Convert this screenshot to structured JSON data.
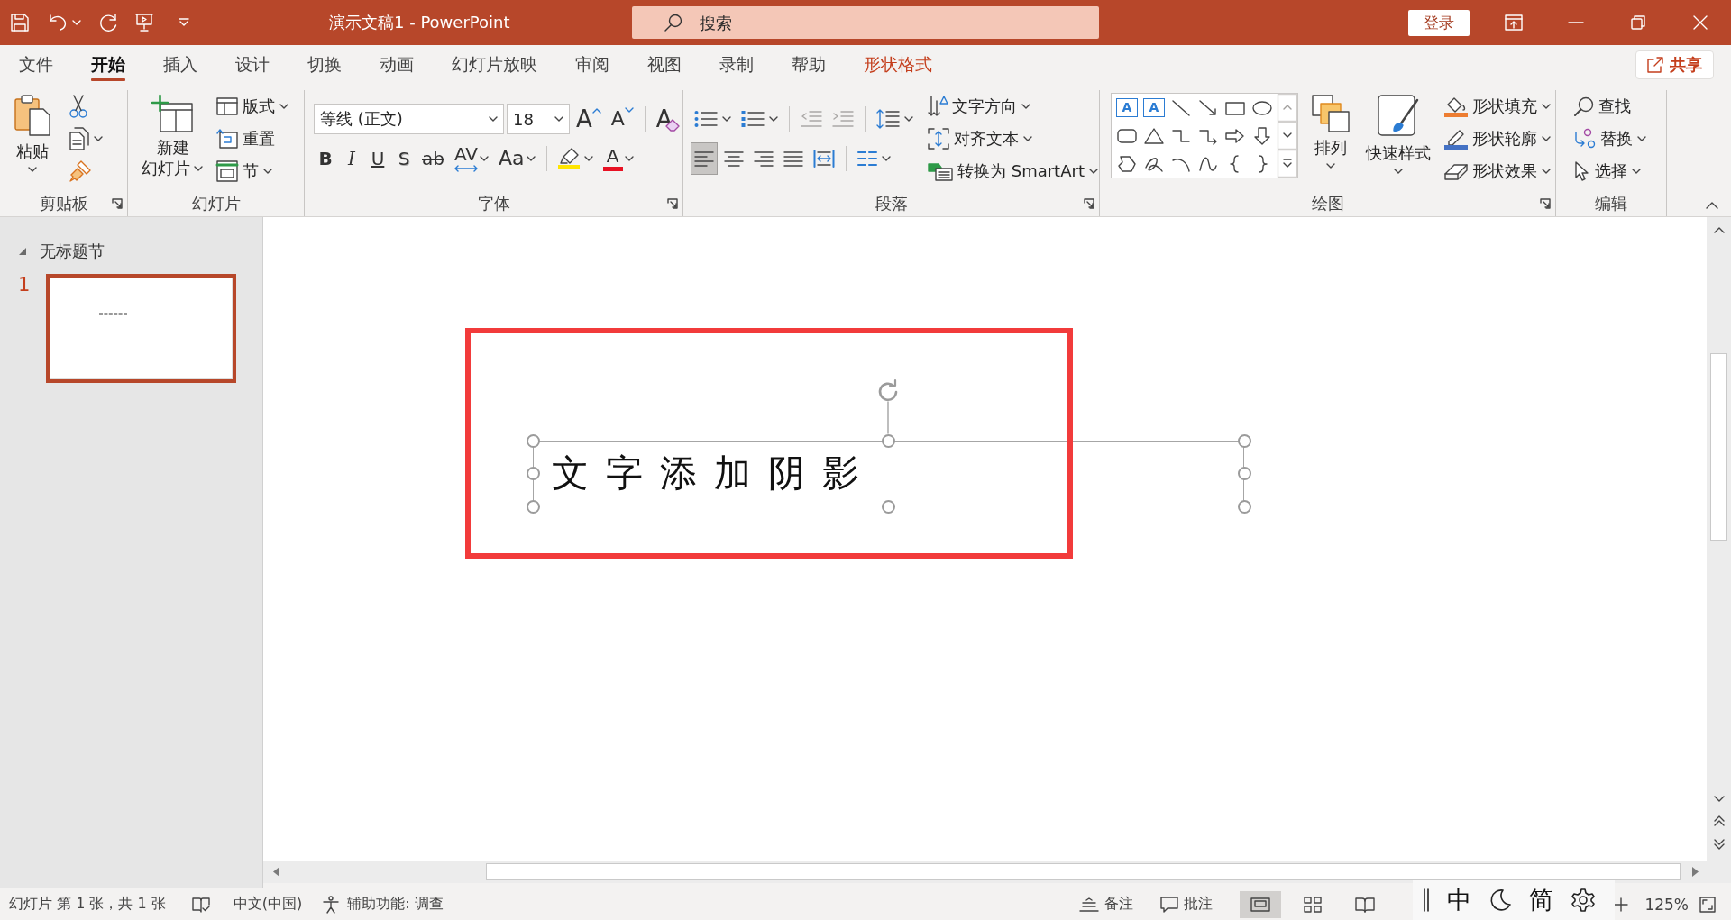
{
  "title_bar": {
    "title": "演示文稿1 - PowerPoint",
    "search": {
      "placeholder": "搜索"
    },
    "sign_in": "登录"
  },
  "tabs": [
    {
      "label": "文件",
      "selected": false,
      "contextual": false
    },
    {
      "label": "开始",
      "selected": true,
      "contextual": false
    },
    {
      "label": "插入",
      "selected": false,
      "contextual": false
    },
    {
      "label": "设计",
      "selected": false,
      "contextual": false
    },
    {
      "label": "切换",
      "selected": false,
      "contextual": false
    },
    {
      "label": "动画",
      "selected": false,
      "contextual": false
    },
    {
      "label": "幻灯片放映",
      "selected": false,
      "contextual": false
    },
    {
      "label": "审阅",
      "selected": false,
      "contextual": false
    },
    {
      "label": "视图",
      "selected": false,
      "contextual": false
    },
    {
      "label": "录制",
      "selected": false,
      "contextual": false
    },
    {
      "label": "帮助",
      "selected": false,
      "contextual": false
    },
    {
      "label": "形状格式",
      "selected": false,
      "contextual": true
    }
  ],
  "share_button": "共享",
  "ribbon": {
    "groups": [
      {
        "label": "剪贴板",
        "launcher": true,
        "columns": [
          {
            "kind": "large",
            "label": "粘贴",
            "dropdown": true
          },
          {
            "kind": "stack",
            "items": [
              {
                "kind": "icon",
                "dropdown": false
              },
              {
                "kind": "icon",
                "dropdown": true
              },
              {
                "kind": "icon",
                "dropdown": false
              }
            ]
          }
        ]
      },
      {
        "label": "幻灯片",
        "launcher": false,
        "columns": [
          {
            "kind": "wide",
            "label": "新建幻灯片",
            "dropdown": true
          },
          {
            "kind": "stack",
            "items": [
              {
                "kind": "small",
                "label": "版式",
                "dropdown": true
              },
              {
                "kind": "small",
                "label": "重置",
                "dropdown": false
              },
              {
                "kind": "small",
                "label": "节",
                "dropdown": true
              }
            ]
          }
        ]
      },
      {
        "label": "字体",
        "launcher": true,
        "columns": [
          {
            "kind": "toolbars",
            "toolbars": [
              {
                "items": [
                  {
                    "kind": "combo",
                    "value": "等线 (正文)"
                  },
                  {
                    "kind": "combo",
                    "value": "18"
                  },
                  {
                    "kind": "glyph",
                    "label": "A",
                    "dropdown": false
                  },
                  {
                    "kind": "glyph",
                    "label": "A",
                    "dropdown": false
                  },
                  {
                    "kind": "separator"
                  },
                  {
                    "kind": "glyph",
                    "label": "A",
                    "dropdown": false
                  }
                ]
              },
              {
                "items": [
                  {
                    "kind": "glyph",
                    "label": "B",
                    "dropdown": false
                  },
                  {
                    "kind": "glyph",
                    "label": "I",
                    "dropdown": false
                  },
                  {
                    "kind": "glyph",
                    "label": "U",
                    "dropdown": false
                  },
                  {
                    "kind": "glyph",
                    "label": "S",
                    "dropdown": false
                  },
                  {
                    "kind": "glyph",
                    "label": "ab",
                    "dropdown": false
                  },
                  {
                    "kind": "glyph",
                    "label": "AV",
                    "dropdown": true
                  },
                  {
                    "kind": "glyph",
                    "label": "Aa",
                    "dropdown": true
                  },
                  {
                    "kind": "separator"
                  },
                  {
                    "kind": "icon",
                    "dropdown": true
                  },
                  {
                    "kind": "glyph",
                    "label": "A",
                    "dropdown": true
                  }
                ]
              }
            ]
          }
        ]
      },
      {
        "label": "段落",
        "launcher": true,
        "columns": [
          {
            "kind": "toolbars",
            "toolbars": [
              {
                "items": [
                  {
                    "kind": "icon",
                    "dropdown": true,
                    "disabled": false
                  },
                  {
                    "kind": "icon",
                    "dropdown": true,
                    "disabled": false
                  },
                  {
                    "kind": "separator"
                  },
                  {
                    "kind": "icon",
                    "dropdown": false,
                    "disabled": true
                  },
                  {
                    "kind": "icon",
                    "dropdown": false,
                    "disabled": true
                  },
                  {
                    "kind": "separator"
                  },
                  {
                    "kind": "icon",
                    "dropdown": true,
                    "disabled": false
                  }
                ]
              },
              {
                "items": [
                  {
                    "kind": "icon",
                    "dropdown": false,
                    "selected": true
                  },
                  {
                    "kind": "icon",
                    "dropdown": false,
                    "selected": false
                  },
                  {
                    "kind": "icon",
                    "dropdown": false,
                    "selected": false
                  },
                  {
                    "kind": "icon",
                    "dropdown": false,
                    "selected": false
                  },
                  {
                    "kind": "icon",
                    "dropdown": false,
                    "selected": false
                  },
                  {
                    "kind": "separator"
                  },
                  {
                    "kind": "icon",
                    "dropdown": true
                  }
                ]
              }
            ]
          },
          {
            "kind": "stack",
            "items": [
              {
                "kind": "small",
                "label": "文字方向",
                "dropdown": true
              },
              {
                "kind": "small",
                "label": "对齐文本",
                "dropdown": true
              },
              {
                "kind": "small",
                "label": "转换为 SmartArt",
                "dropdown": true
              }
            ]
          }
        ]
      },
      {
        "label": "绘图",
        "launcher": true,
        "columns": [
          {
            "kind": "gallery",
            "items": [
              {
                "kind": "text",
                "label": "A"
              },
              {
                "kind": "text",
                "label": "A"
              },
              {
                "kind": "shape"
              },
              {
                "kind": "shape"
              },
              {
                "kind": "shape"
              },
              {
                "kind": "shape"
              },
              {
                "kind": "shape"
              },
              {
                "kind": "shape"
              },
              {
                "kind": "shape"
              },
              {
                "kind": "shape"
              },
              {
                "kind": "shape"
              },
              {
                "kind": "shape"
              },
              {
                "kind": "shape"
              },
              {
                "kind": "shape"
              },
              {
                "kind": "shape"
              },
              {
                "kind": "shape"
              },
              {
                "kind": "shape"
              },
              {
                "kind": "shape"
              }
            ]
          },
          {
            "kind": "large",
            "label": "排列",
            "dropdown": true
          },
          {
            "kind": "large",
            "label": "快速样式",
            "dropdown": true
          },
          {
            "kind": "stack",
            "items": [
              {
                "kind": "small",
                "label": "形状填充",
                "dropdown": true
              },
              {
                "kind": "small",
                "label": "形状轮廓",
                "dropdown": true
              },
              {
                "kind": "small",
                "label": "形状效果",
                "dropdown": true
              }
            ]
          }
        ]
      },
      {
        "label": "编辑",
        "launcher": false,
        "columns": [
          {
            "kind": "stack",
            "items": [
              {
                "kind": "small",
                "label": "查找",
                "dropdown": false
              },
              {
                "kind": "small",
                "label": "替换",
                "dropdown": true
              },
              {
                "kind": "small",
                "label": "选择",
                "dropdown": true
              }
            ]
          }
        ]
      }
    ]
  },
  "slides_pane": {
    "sections": [
      {
        "title": "无标题节",
        "expanded": true,
        "slides": [
          {
            "number": "1",
            "selected": true
          }
        ]
      }
    ]
  },
  "slide": {
    "text_box": {
      "text": "文 字 添 加 阴 影",
      "selected": true
    },
    "annotations": [
      {
        "kind": "frame"
      }
    ]
  },
  "status_bar": {
    "slide_info": "幻灯片 第 1 张，共 1 张",
    "language": "中文(中国)",
    "accessibility": "辅助功能: 调查",
    "notes": "备注",
    "comments": "批注",
    "views": [
      {
        "selected": true
      },
      {
        "selected": false
      },
      {
        "selected": false
      }
    ],
    "zoom": "125%"
  },
  "ime_bar": {
    "mode": "中",
    "charset": "简"
  }
}
